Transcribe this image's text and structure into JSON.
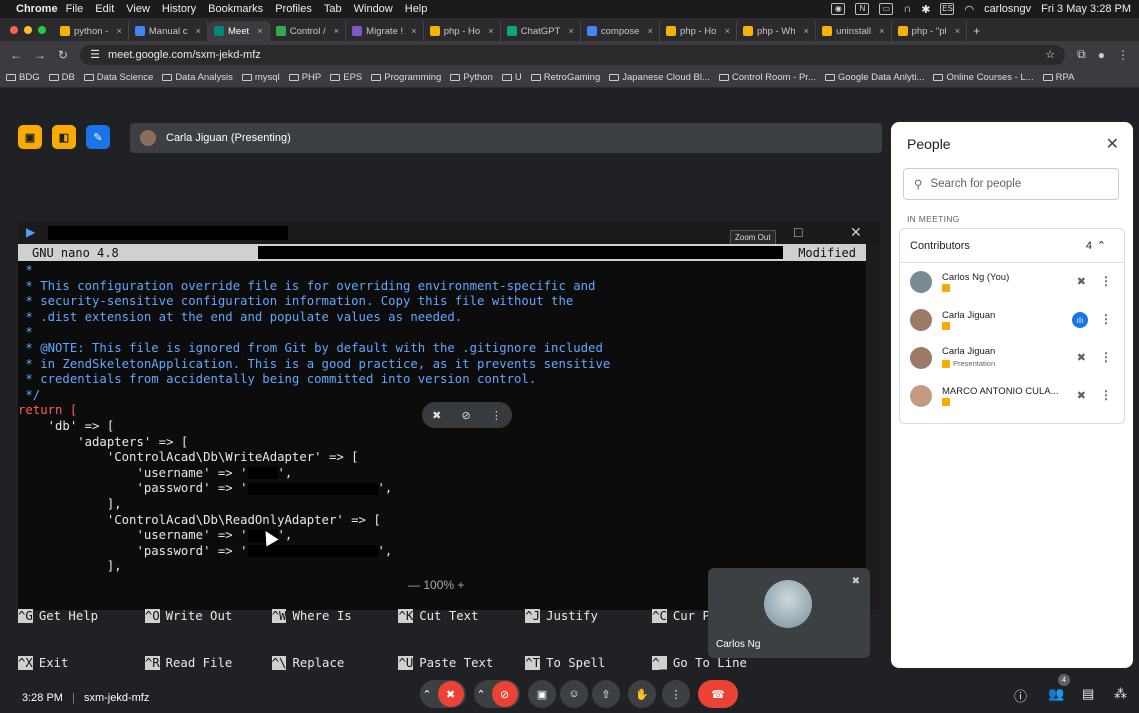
{
  "menubar": {
    "app": "Chrome",
    "items": [
      "File",
      "Edit",
      "View",
      "History",
      "Bookmarks",
      "Profiles",
      "Tab",
      "Window",
      "Help"
    ],
    "user": "carlosngv",
    "datetime": "Fri 3 May  3:28 PM"
  },
  "tabs": [
    {
      "label": "python -",
      "color": "#f4b400",
      "active": false
    },
    {
      "label": "Manual c",
      "color": "#4285f4",
      "active": false
    },
    {
      "label": "Meet",
      "color": "#00897b",
      "active": true
    },
    {
      "label": "Control /",
      "color": "#34a853",
      "active": false
    },
    {
      "label": "Migrate !",
      "color": "#7e57c2",
      "active": false
    },
    {
      "label": "php - Ho",
      "color": "#f4b400",
      "active": false
    },
    {
      "label": "ChatGPT",
      "color": "#10a37f",
      "active": false
    },
    {
      "label": "compose",
      "color": "#4285f4",
      "active": false
    },
    {
      "label": "php - Ho",
      "color": "#f4b400",
      "active": false
    },
    {
      "label": "php - Wh",
      "color": "#f4b400",
      "active": false
    },
    {
      "label": "uninstall",
      "color": "#f4b400",
      "active": false
    },
    {
      "label": "php - \"pl",
      "color": "#f4b400",
      "active": false
    }
  ],
  "address": {
    "url": "meet.google.com/sxm-jekd-mfz"
  },
  "bookmarks": [
    "BDG",
    "DB",
    "Data Science",
    "Data Analysis",
    "mysql",
    "PHP",
    "EPS",
    "Programming",
    "Python",
    "U",
    "RetroGaming",
    "Japanese Cloud Bl...",
    "Control Room - Pr...",
    "Google Data Anlyti...",
    "Online Courses - L...",
    "RPA"
  ],
  "presenting": {
    "label": "Carla Jiguan (Presenting)"
  },
  "terminal": {
    "zoom_tip": "Zoom Out",
    "nano_title": "GNU nano 4.8",
    "modified": "Modified",
    "lines": [
      {
        "cls": "cm",
        "text": " *"
      },
      {
        "cls": "cm",
        "text": " * This configuration override file is for overriding environment-specific and"
      },
      {
        "cls": "cm",
        "text": " * security-sensitive configuration information. Copy this file without the"
      },
      {
        "cls": "cm",
        "text": " * .dist extension at the end and populate values as needed."
      },
      {
        "cls": "cm",
        "text": " *"
      },
      {
        "cls": "cm",
        "text": " * @NOTE: This file is ignored from Git by default with the .gitignore included"
      },
      {
        "cls": "cm",
        "text": " * in ZendSkeletonApplication. This is a good practice, as it prevents sensitive"
      },
      {
        "cls": "cm",
        "text": " * credentials from accidentally being committed into version control."
      },
      {
        "cls": "cm",
        "text": " */"
      },
      {
        "cls": "kw",
        "text": "return ["
      },
      {
        "cls": "st",
        "text": "    'db' => ["
      },
      {
        "cls": "st",
        "text": "        'adapters' => ["
      },
      {
        "cls": "st",
        "text": "            'ControlAcad\\Db\\WriteAdapter' => ["
      },
      {
        "cls": "st",
        "text": "                'username' => '"
      },
      {
        "cls": "st",
        "text": "                'password' => '"
      },
      {
        "cls": "st",
        "text": "            ],"
      },
      {
        "cls": "st",
        "text": "            'ControlAcad\\Db\\ReadOnlyAdapter' => ["
      },
      {
        "cls": "st",
        "text": "                'username' => '"
      },
      {
        "cls": "st",
        "text": "                'password' => '"
      },
      {
        "cls": "st",
        "text": "            ],"
      }
    ],
    "help_row1": [
      {
        "k": "^G",
        "t": "Get Help"
      },
      {
        "k": "^O",
        "t": "Write Out"
      },
      {
        "k": "^W",
        "t": "Where Is"
      },
      {
        "k": "^K",
        "t": "Cut Text"
      },
      {
        "k": "^J",
        "t": "Justify"
      },
      {
        "k": "^C",
        "t": "Cur Pos"
      }
    ],
    "help_row2": [
      {
        "k": "^X",
        "t": "Exit"
      },
      {
        "k": "^R",
        "t": "Read File"
      },
      {
        "k": "^\\",
        "t": "Replace"
      },
      {
        "k": "^U",
        "t": "Paste Text"
      },
      {
        "k": "^T",
        "t": "To Spell"
      },
      {
        "k": "^_",
        "t": "Go To Line"
      }
    ],
    "zoom_level": "100%"
  },
  "self_tile": {
    "name": "Carlos Ng"
  },
  "people": {
    "title": "People",
    "search_placeholder": "Search for people",
    "section": "IN MEETING",
    "group": "Contributors",
    "count": "4",
    "list": [
      {
        "name": "Carlos Ng (You)",
        "sub": "",
        "mic": "muted",
        "avatar": "#7a8a95"
      },
      {
        "name": "Carla Jiguan",
        "sub": "",
        "mic": "speaking",
        "avatar": "#9b7b66"
      },
      {
        "name": "Carla Jiguan",
        "sub": "Presentation",
        "mic": "muted",
        "avatar": "#9b7b66"
      },
      {
        "name": "MARCO ANTONIO CULA...",
        "sub": "",
        "mic": "muted",
        "avatar": "#c49a80"
      }
    ]
  },
  "bottom": {
    "time": "3:28 PM",
    "code": "sxm-jekd-mfz",
    "participants": "4"
  }
}
